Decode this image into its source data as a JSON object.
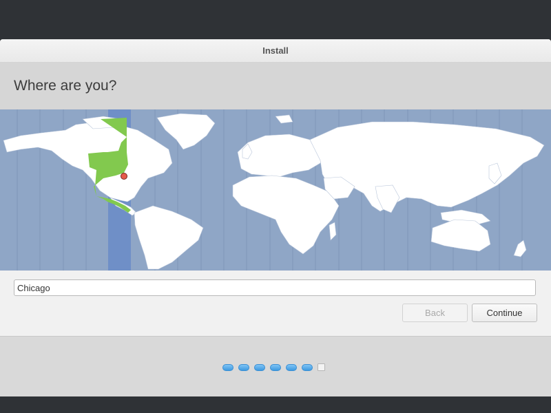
{
  "window": {
    "title": "Install"
  },
  "page": {
    "heading": "Where are you?"
  },
  "location": {
    "value": "Chicago",
    "placeholder": ""
  },
  "buttons": {
    "back": "Back",
    "continue": "Continue"
  },
  "progress": {
    "completed_steps": 6,
    "total_steps": 7,
    "current_step": 7
  },
  "colors": {
    "ocean": "#8fa6c6",
    "land": "#ffffff",
    "selected_timezone_band": "#6f8fc7",
    "selected_region": "#82c94e",
    "location_pin": "#e55b4b",
    "progress_dot": "#4aa3e6"
  },
  "icons": {
    "map_marker": "location-pin-icon"
  }
}
